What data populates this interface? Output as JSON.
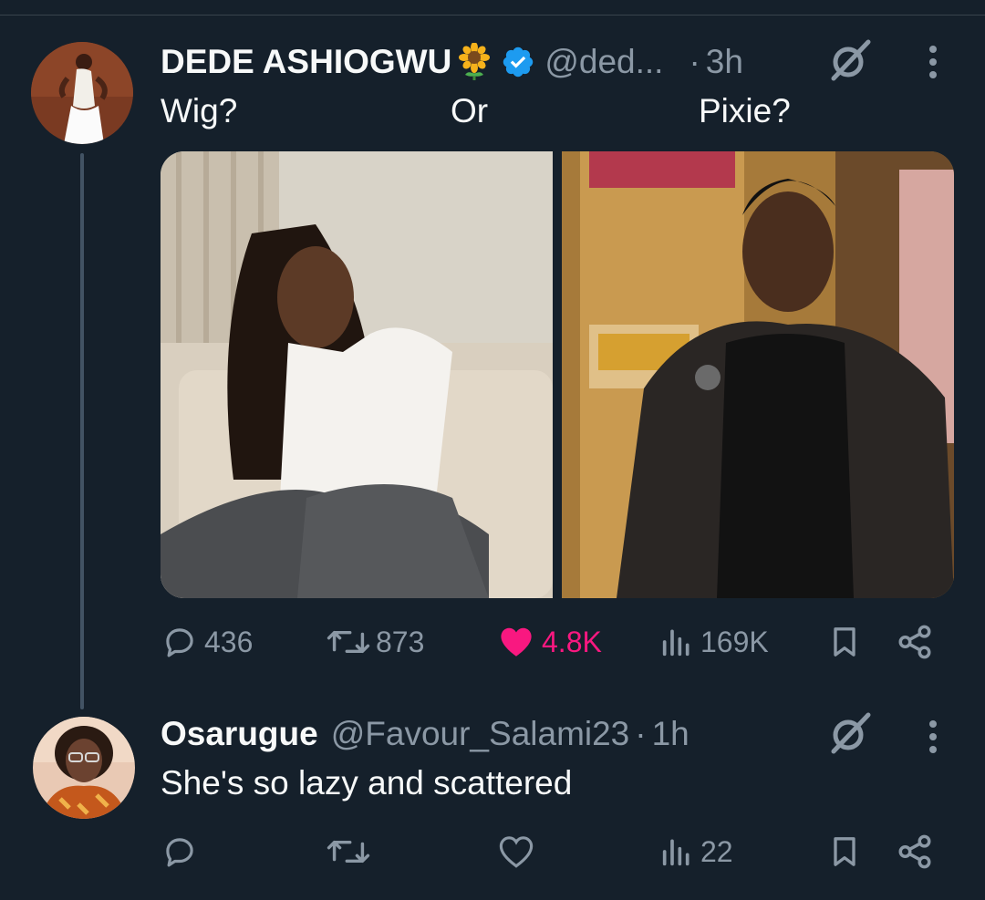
{
  "tweet": {
    "author_name": "DEDE ASHIOGWU",
    "handle": "@ded...",
    "separator": "·",
    "time": "3h",
    "text_parts": [
      "Wig?",
      "Or",
      "Pixie?"
    ],
    "stats": {
      "replies": "436",
      "reposts": "873",
      "likes": "4.8K",
      "views": "169K"
    },
    "liked": true
  },
  "reply": {
    "author_name": "Osarugue",
    "handle": "@Favour_Salami23",
    "separator": "·",
    "time": "1h",
    "text": "She's so lazy and scattered",
    "stats": {
      "views": "22"
    }
  },
  "colors": {
    "background": "#15202b",
    "secondary_text": "#8b98a5",
    "like_pink": "#f91880",
    "verified_blue": "#1d9bf0"
  },
  "icons": {
    "reply": "speech-bubble",
    "repost": "repeat-arrows",
    "like": "heart",
    "views": "bar-chart",
    "bookmark": "bookmark",
    "share": "share-nodes",
    "grok": "grok-slash-circle",
    "more": "vertical-ellipsis",
    "verified": "blue-check-badge",
    "emoji": "sunflower"
  }
}
